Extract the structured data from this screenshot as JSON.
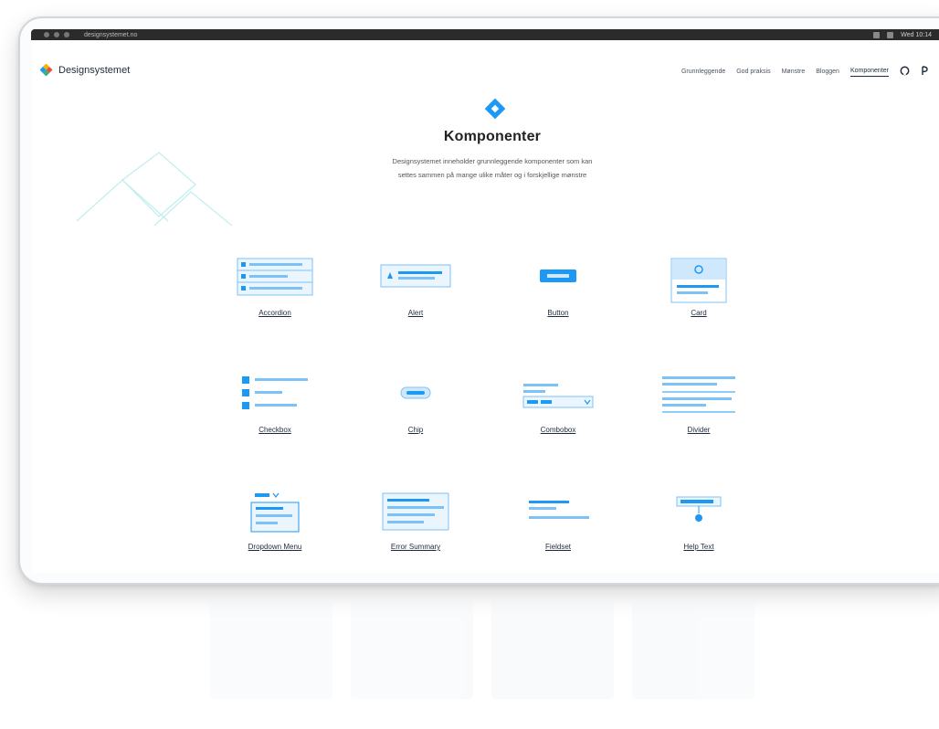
{
  "browser": {
    "url_text": "designsystemet.no",
    "clock": "Wed 10:14"
  },
  "site": {
    "logo_text": "Designsystemet",
    "nav": [
      {
        "label": "Grunnleggende"
      },
      {
        "label": "God praksis"
      },
      {
        "label": "Mønstre"
      },
      {
        "label": "Bloggen"
      },
      {
        "label": "Komponenter"
      }
    ],
    "active_nav": "Komponenter"
  },
  "hero": {
    "title": "Komponenter",
    "desc_line1": "Designsystemet inneholder grunnleggende komponenter som kan",
    "desc_line2": "settes sammen på mange ulike måter og i forskjellige mønstre"
  },
  "components": [
    {
      "label": "Accordion"
    },
    {
      "label": "Alert"
    },
    {
      "label": "Button"
    },
    {
      "label": "Card"
    },
    {
      "label": "Checkbox"
    },
    {
      "label": "Chip"
    },
    {
      "label": "Combobox"
    },
    {
      "label": "Divider"
    },
    {
      "label": "Dropdown Menu"
    },
    {
      "label": "Error Summary"
    },
    {
      "label": "Fieldset"
    },
    {
      "label": "Help Text"
    }
  ],
  "colors": {
    "accent": "#1e98f5",
    "accent_light": "#cfe8fc",
    "accent_mid": "#7cc2f7",
    "dark": "#1e2b3c",
    "deco": "#bfeef0"
  },
  "icons": {
    "logo": "designsystemet-logo-icon",
    "github": "github-icon",
    "theme": "theme-toggle-icon"
  }
}
